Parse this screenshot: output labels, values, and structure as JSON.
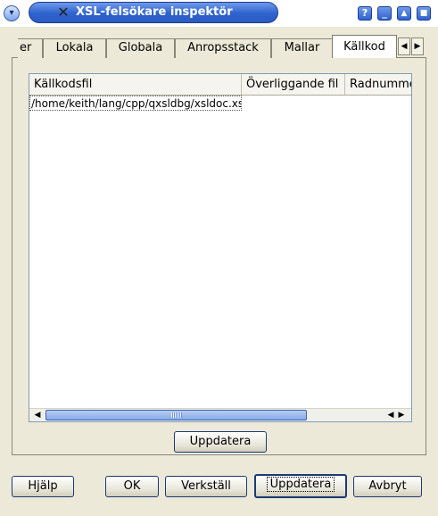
{
  "window": {
    "title": "XSL-felsökare inspektör",
    "title_buttons": [
      "?",
      "_",
      "▲",
      "■"
    ]
  },
  "tabs": {
    "items": [
      "er",
      "Lokala",
      "Globala",
      "Anropsstack",
      "Mallar",
      "Källkod"
    ],
    "active": "Källkod"
  },
  "list": {
    "columns": [
      "Källkodsfil",
      "Överliggande fil",
      "Radnumme"
    ],
    "rows": [
      [
        "/home/keith/lang/cpp/qxsldbg/xsldoc.xsl",
        "",
        ""
      ]
    ]
  },
  "inner_buttons": {
    "refresh": "Uppdatera"
  },
  "footer": {
    "help": "Hjälp",
    "ok": "OK",
    "apply": "Verkställ",
    "refresh": "Uppdatera",
    "cancel": "Avbryt"
  },
  "colors": {
    "title_bar": "#2e63cf",
    "button_border": "#1d3a74",
    "window_bg": "#ece9d8"
  }
}
